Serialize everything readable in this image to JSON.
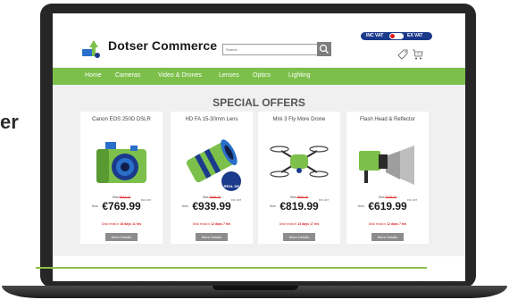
{
  "side_text": "er",
  "header": {
    "brand": "Dotser Commerce",
    "search_placeholder": "Search",
    "vat_inc": "INC VAT",
    "vat_ex": "EX VAT",
    "cart_count": "0"
  },
  "nav": [
    "Home",
    "Cameras",
    "Video & Drones",
    "Lenses",
    "Optics",
    "Lighting"
  ],
  "offers_title": "SPECIAL OFFERS",
  "products": [
    {
      "name": "Canon EOS 250D DSLR",
      "was_label": "Was",
      "was_price": "€849.00",
      "now_label": "Now",
      "price": "€769.99",
      "vat_tag": "INC VAT",
      "deal_prefix": "Deal ends in",
      "deal_time": "16 days 11 hrs",
      "button": "More Details"
    },
    {
      "name": "HD FA 15-30mm Lens",
      "was_label": "Was",
      "was_price": "€999.00",
      "now_label": "Now",
      "price": "€939.99",
      "vat_tag": "INC VAT",
      "deal_prefix": "Deal ends in",
      "deal_time": "12 days 7 hrs",
      "button": "More Details",
      "badge": "REAL DEAL"
    },
    {
      "name": "Mini 3 Fly More Drone",
      "was_label": "Was",
      "was_price": "€869.00",
      "now_label": "Now",
      "price": "€819.99",
      "vat_tag": "INC VAT",
      "deal_prefix": "Deal ends in",
      "deal_time": "13 days 17 hrs",
      "button": "More Details"
    },
    {
      "name": "Flash Head & Reflector",
      "was_label": "Was",
      "was_price": "€759.00",
      "now_label": "Now",
      "price": "€619.99",
      "vat_tag": "INC VAT",
      "deal_prefix": "Deal ends in",
      "deal_time": "12 days 7 hrs",
      "button": "More Details"
    }
  ],
  "colors": {
    "nav": "#7cc04b",
    "vat_toggle": "#1c3a8c",
    "laptop": "#262626",
    "accent_line": "#8dbf4a"
  }
}
